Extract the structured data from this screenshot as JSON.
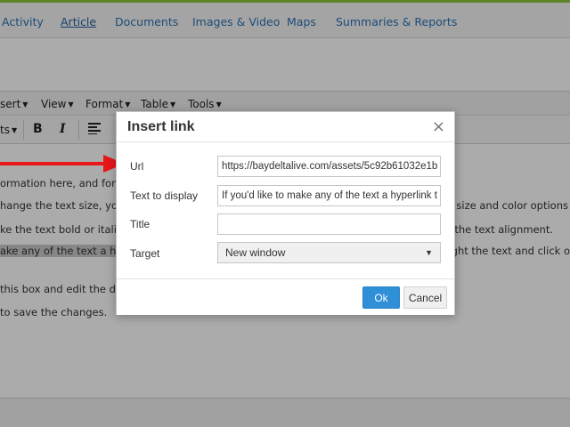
{
  "nav": {
    "items": [
      "Activity",
      "Article",
      "Documents",
      "Images & Video",
      "Maps",
      "Summaries & Reports"
    ],
    "active": "Article"
  },
  "editor": {
    "menus": [
      "sert",
      "View",
      "Format",
      "Table",
      "Tools"
    ],
    "toolbar": {
      "styles": "ts",
      "bold": "B",
      "italic": "I"
    },
    "lines": [
      "ormation here, and forma",
      "hange the text size, you ca",
      "ke the text bold or italic u",
      "ake any of the text a hype",
      "this box and edit the disp",
      " to save the changes."
    ],
    "right_fragments": [
      "eral size and color options",
      "nd the text alignment.",
      "ghlight the text and click o"
    ]
  },
  "dialog": {
    "title": "Insert link",
    "close": "×",
    "fields": {
      "url_label": "Url",
      "url_value": "https://baydeltalive.com/assets/5c92b61032e1b",
      "text_label": "Text to display",
      "text_value": "If you'd like to make any of the text a hyperlink t",
      "title_label": "Title",
      "title_value": "",
      "target_label": "Target",
      "target_value": "New window"
    },
    "ok": "Ok",
    "cancel": "Cancel"
  },
  "colors": {
    "accent": "#2f8fd7",
    "arrow": "#e8161a",
    "nav_link": "#2a72b5",
    "top_line": "#8cc63f"
  }
}
